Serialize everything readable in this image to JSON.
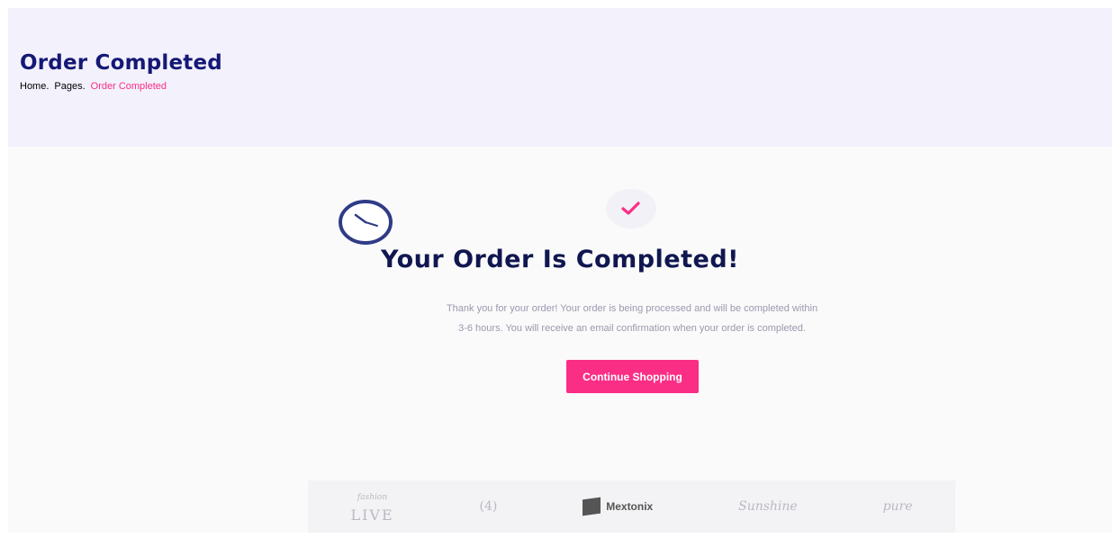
{
  "header": {
    "title": "Order Completed",
    "breadcrumb": [
      "Home.",
      "Pages.",
      "Order Completed"
    ]
  },
  "confirmation": {
    "title": "Your Order Is Completed!",
    "message_line1": "Thank you for your order! Your order is being processed and will be completed within",
    "message_line2": "3-6 hours. You will receive an email confirmation when your order is completed.",
    "button_label": "Continue Shopping"
  },
  "brands": [
    {
      "top": "fashion",
      "bottom": "LIVE"
    },
    {
      "label": "(4)"
    },
    {
      "label": "Mextonix"
    },
    {
      "label": "Sunshine"
    },
    {
      "label": "pure"
    }
  ],
  "colors": {
    "brand_pink": "#fb2e86",
    "navy": "#151875",
    "hero_bg": "#f2f1fc"
  },
  "icons": [
    "check-icon",
    "clock-icon"
  ]
}
